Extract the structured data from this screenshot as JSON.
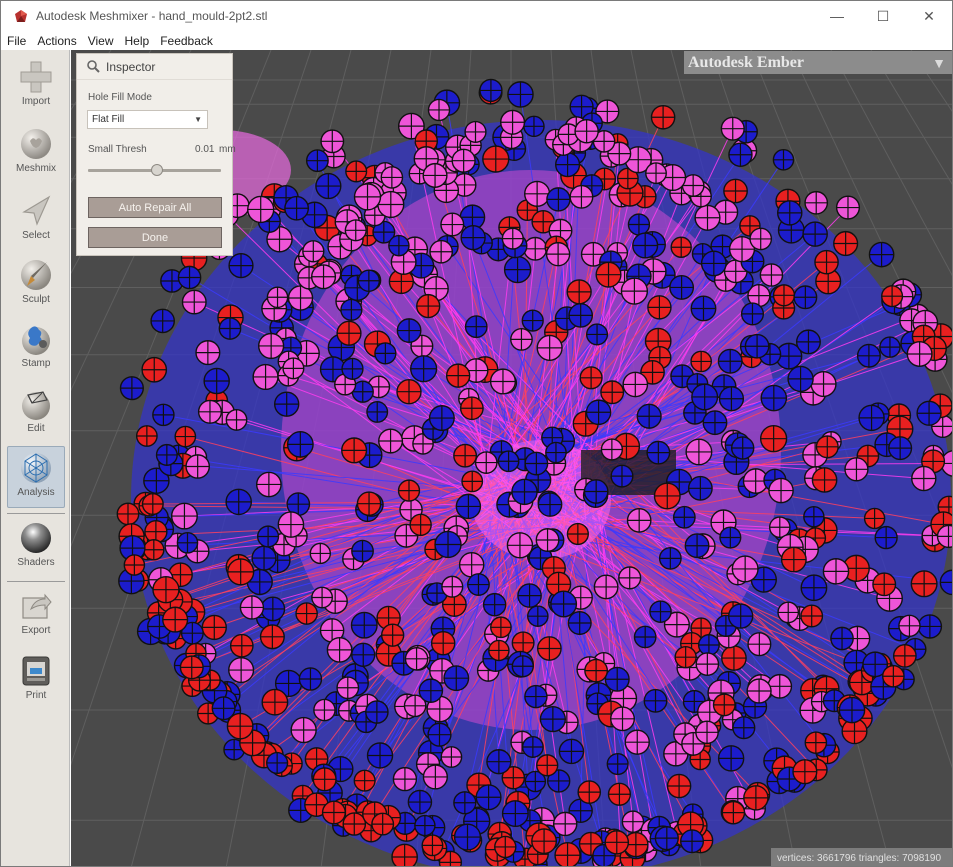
{
  "window": {
    "title": "Autodesk Meshmixer - hand_mould-2pt2.stl",
    "minimize": "—",
    "maximize": "☐",
    "close": "✕"
  },
  "menu": [
    "File",
    "Actions",
    "View",
    "Help",
    "Feedback"
  ],
  "toolbar": {
    "tools": [
      {
        "label": "Import",
        "icon": "plus-icon"
      },
      {
        "label": "Meshmix",
        "icon": "bunny-sphere-icon"
      },
      {
        "label": "Select",
        "icon": "arrow-cursor-icon"
      },
      {
        "label": "Sculpt",
        "icon": "brush-icon"
      },
      {
        "label": "Stamp",
        "icon": "stamp-icon"
      },
      {
        "label": "Edit",
        "icon": "edit-cube-icon"
      },
      {
        "label": "Analysis",
        "icon": "analysis-sphere-icon",
        "active": true
      },
      {
        "label": "Shaders",
        "icon": "shader-sphere-icon"
      },
      {
        "label": "Export",
        "icon": "export-icon"
      },
      {
        "label": "Print",
        "icon": "printer-icon"
      }
    ]
  },
  "inspector": {
    "title": "Inspector",
    "hole_fill_label": "Hole Fill Mode",
    "hole_fill_value": "Flat Fill",
    "small_thresh_label": "Small Thresh",
    "small_thresh_value": "0.01",
    "small_thresh_unit": "mm",
    "slider_fraction": 0.52,
    "auto_repair_label": "Auto Repair All",
    "done_label": "Done"
  },
  "ember": {
    "label": "Autodesk Ember",
    "arrow": "▼"
  },
  "status": {
    "text": "vertices: 3661796 triangles: 7098190"
  },
  "colors": {
    "viewport_bg": "#4a4a4a",
    "marker_pink": "#ee55d8",
    "marker_blue": "#1c1ccc",
    "marker_red": "#e82020",
    "line_pink": "#ff3cf0",
    "line_blue": "#3a3aff"
  }
}
